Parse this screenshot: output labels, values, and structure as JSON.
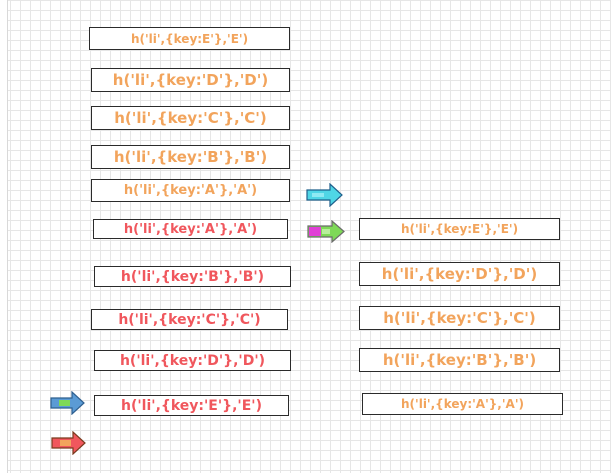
{
  "column_old": {
    "items": [
      {
        "label": "h('li',{key:E'},'E')"
      },
      {
        "label": "h('li',{key:'D'},'D')"
      },
      {
        "label": "h('li',{key:'C'},'C')"
      },
      {
        "label": "h('li',{key:'B'},'B')"
      },
      {
        "label": "h('li',{key:'A'},'A')"
      }
    ]
  },
  "column_new": {
    "items": [
      {
        "label": "h('li',{key:'A'},'A')"
      },
      {
        "label": "h('li',{key:'B'},'B')"
      },
      {
        "label": "h('li',{key:'C'},'C')"
      },
      {
        "label": "h('li',{key:'D'},'D')"
      },
      {
        "label": "h('li',{key:'E'},'E')"
      }
    ]
  },
  "column_result": {
    "items": [
      {
        "label": "h('li',{key:E'},'E')"
      },
      {
        "label": "h('li',{key:'D'},'D')"
      },
      {
        "label": "h('li',{key:'C'},'C')"
      },
      {
        "label": "h('li',{key:'B'},'B')"
      },
      {
        "label": "h('li',{key:'A'},'A')"
      }
    ]
  },
  "colors": {
    "old_text": "#f2a45c",
    "new_text": "#f0575d",
    "box_border": "#2b2b2b",
    "grid": "#e6e6e6"
  },
  "pointers": [
    {
      "name": "cyan-arrow-icon",
      "fill": "#4fd6e6"
    },
    {
      "name": "magenta-green-arrow-icon",
      "fill": "#7ed957",
      "accent": "#e040d6"
    },
    {
      "name": "blue-green-arrow-icon",
      "fill": "#5b9bd5",
      "accent": "#7ed957"
    },
    {
      "name": "red-orange-arrow-icon",
      "fill": "#f0575d",
      "accent": "#f2a45c"
    }
  ]
}
